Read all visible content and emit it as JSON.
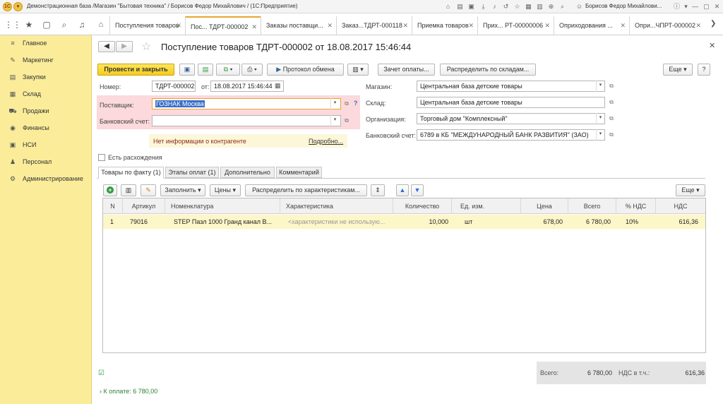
{
  "window": {
    "title": "Демонстрационная база /Магазин \"Бытовая техника\" / Борисов Федор Михайлович / (1С:Предприятие)",
    "user": "Борисов Федор Михайлови..."
  },
  "tabs": [
    {
      "label": "Поступления товаров"
    },
    {
      "label": "Пос... ТДРТ-000002"
    },
    {
      "label": "Заказы поставщи..."
    },
    {
      "label": "Заказ...ТДРТ-000118"
    },
    {
      "label": "Приемка товаров"
    },
    {
      "label": "Прих... РТ-00000006"
    },
    {
      "label": "Оприходования ..."
    },
    {
      "label": "Опри...ЧПРТ-000002"
    }
  ],
  "sidebar": {
    "items": [
      {
        "label": "Главное",
        "icon": "menu-icon"
      },
      {
        "label": "Маркетинг",
        "icon": "marketing-icon"
      },
      {
        "label": "Закупки",
        "icon": "cart-icon"
      },
      {
        "label": "Склад",
        "icon": "warehouse-icon"
      },
      {
        "label": "Продажи",
        "icon": "sales-icon"
      },
      {
        "label": "Финансы",
        "icon": "finance-icon"
      },
      {
        "label": "НСИ",
        "icon": "catalog-icon"
      },
      {
        "label": "Персонал",
        "icon": "person-icon"
      },
      {
        "label": "Администрирование",
        "icon": "gear-icon"
      }
    ]
  },
  "doc": {
    "title": "Поступление товаров ТДРТ-000002 от 18.08.2017 15:46:44",
    "post_close": "Провести и закрыть",
    "exchange_protocol": "Протокол обмена",
    "payment_offset": "Зачет оплаты...",
    "distribute_warehouses": "Распределить по складам...",
    "more": "Еще",
    "help": "?"
  },
  "form": {
    "number_label": "Номер:",
    "number": "ТДРТ-000002",
    "date_label": "от:",
    "date": "18.08.2017 15:46:44",
    "supplier_label": "Поставщик:",
    "supplier": "ГОЗНАК Москва",
    "bank_account_label": "Банковский счет:",
    "bank_account": "",
    "no_info": "Нет информации о контрагенте",
    "details_link": "Подробно...",
    "store_label": "Магазин:",
    "store": "Центральная база детские товары",
    "warehouse_label": "Склад:",
    "warehouse": "Центральная база детские товары",
    "org_label": "Организация:",
    "org": "Торговый дом \"Комплексный\"",
    "org_bank_label": "Банковский счет:",
    "org_bank": "6789 в КБ \"МЕЖДУНАРОДНЫЙ БАНК РАЗВИТИЯ\" (ЗАО)",
    "discrepancy_label": "Есть расхождения",
    "discrepancy_checked": false
  },
  "subtabs": [
    {
      "label": "Товары по факту (1)"
    },
    {
      "label": "Этапы оплат (1)"
    },
    {
      "label": "Дополнительно"
    },
    {
      "label": "Комментарий"
    }
  ],
  "table_toolbar": {
    "fill": "Заполнить",
    "prices": "Цены",
    "distribute_chars": "Распределить по характеристикам...",
    "more": "Еще"
  },
  "table": {
    "columns": [
      "N",
      "Артикул",
      "Номенклатура",
      "Характеристика",
      "Количество",
      "Ед. изм.",
      "Цена",
      "Всего",
      "% НДС",
      "НДС"
    ],
    "rows": [
      {
        "n": "1",
        "article": "79016",
        "name": "STEP Пазл 1000 Гранд канал В...",
        "characteristic": "<характеристики не использую...",
        "qty": "10,000",
        "unit": "шт",
        "price": "678,00",
        "total": "6 780,00",
        "vat_rate": "10%",
        "vat": "616,36"
      }
    ]
  },
  "totals": {
    "total_label": "Всего:",
    "total": "6 780,00",
    "vat_label": "НДС в т.ч.:",
    "vat": "616,36"
  },
  "payment": {
    "label": "К оплате: 6 780,00"
  },
  "colors": {
    "sidebar": "#fbec9a",
    "accent": "#f6cc1c",
    "highlight": "#fbd9dc",
    "selected_row": "#fdf6c8"
  }
}
